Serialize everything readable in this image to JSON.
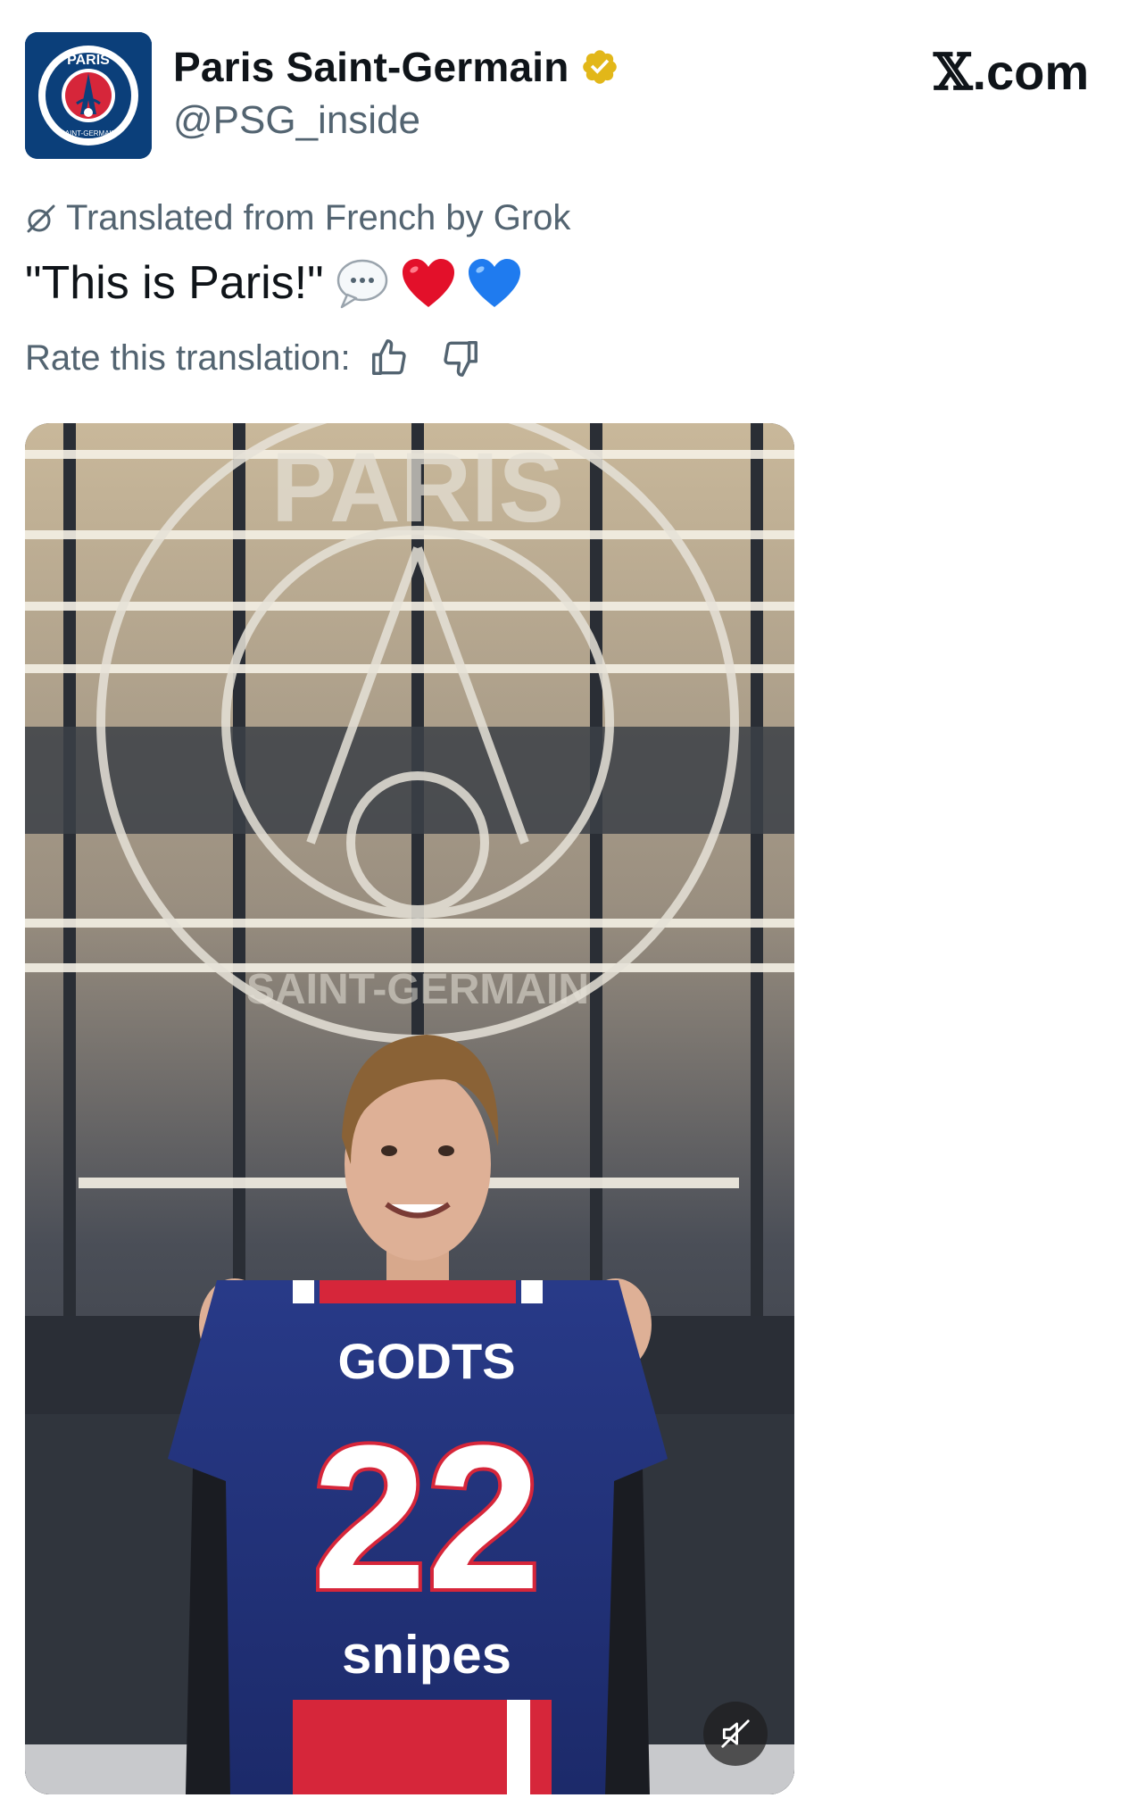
{
  "account": {
    "display_name": "Paris Saint-Germain",
    "handle": "@PSG_inside",
    "avatar_icon": "psg-crest-icon",
    "avatar_text_top": "PARIS",
    "avatar_text_bottom": "SAINT-GERMAIN",
    "verified_icon": "verified-badge-icon",
    "verified_color": "#e2b719"
  },
  "brand": {
    "label": ".com",
    "mark": "𝕏"
  },
  "translation": {
    "icon": "grok-icon",
    "label": "Translated from French by Grok",
    "rate_label": "Rate this translation:",
    "thumbs_up_icon": "thumbs-up-icon",
    "thumbs_down_icon": "thumbs-down-icon"
  },
  "post": {
    "text": "\"This is Paris!\"",
    "emojis": [
      "speech-bubble-emoji",
      "red-heart-emoji",
      "blue-heart-emoji"
    ]
  },
  "media": {
    "type": "video",
    "jersey_name": "GODTS",
    "jersey_number": "22",
    "jersey_sponsor": "snipes",
    "mute_icon": "muted-speaker-icon",
    "building_logo_text": "PARIS",
    "building_logo_bottom": "SAINT-GERMAIN"
  },
  "colors": {
    "text_primary": "#0f1419",
    "text_secondary": "#536471",
    "psg_navy": "#0b3f7a",
    "psg_red": "#d6263a"
  }
}
